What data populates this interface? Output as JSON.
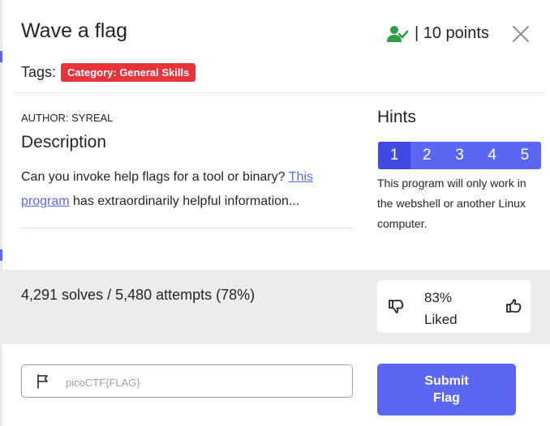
{
  "challenge": {
    "title": "Wave a flag",
    "points": "| 10 points",
    "tags_label": "Tags:",
    "tags": [
      "Category: General Skills"
    ],
    "author": "AUTHOR: SYREAL",
    "description_heading": "Description",
    "description": {
      "before_link": "Can you invoke help flags for a tool or binary? ",
      "link_text": "This program",
      "after_link": " has extraordinarily helpful information..."
    }
  },
  "hints": {
    "heading": "Hints",
    "tabs": [
      "1",
      "2",
      "3",
      "4",
      "5"
    ],
    "active_tab": "1",
    "text": "This program will only work in the webshell or another Linux computer."
  },
  "stats": {
    "solves": "4,291 solves / 5,480 attempts (78%)",
    "liked_percent": "83%",
    "liked_label": "Liked"
  },
  "submission": {
    "placeholder": "picoCTF{FLAG}",
    "value": "",
    "submit_label_line1": "Submit",
    "submit_label_line2": "Flag"
  },
  "icons": {
    "user": "user-check-icon",
    "close": "close-icon",
    "thumbs_down": "thumbs-down-icon",
    "thumbs_up": "thumbs-up-icon",
    "flag": "flag-icon"
  },
  "colors": {
    "accent": "#5b67f2",
    "tag_red": "#e8323c",
    "user_icon_green": "#2f9e44",
    "band_gray": "#ececec"
  }
}
